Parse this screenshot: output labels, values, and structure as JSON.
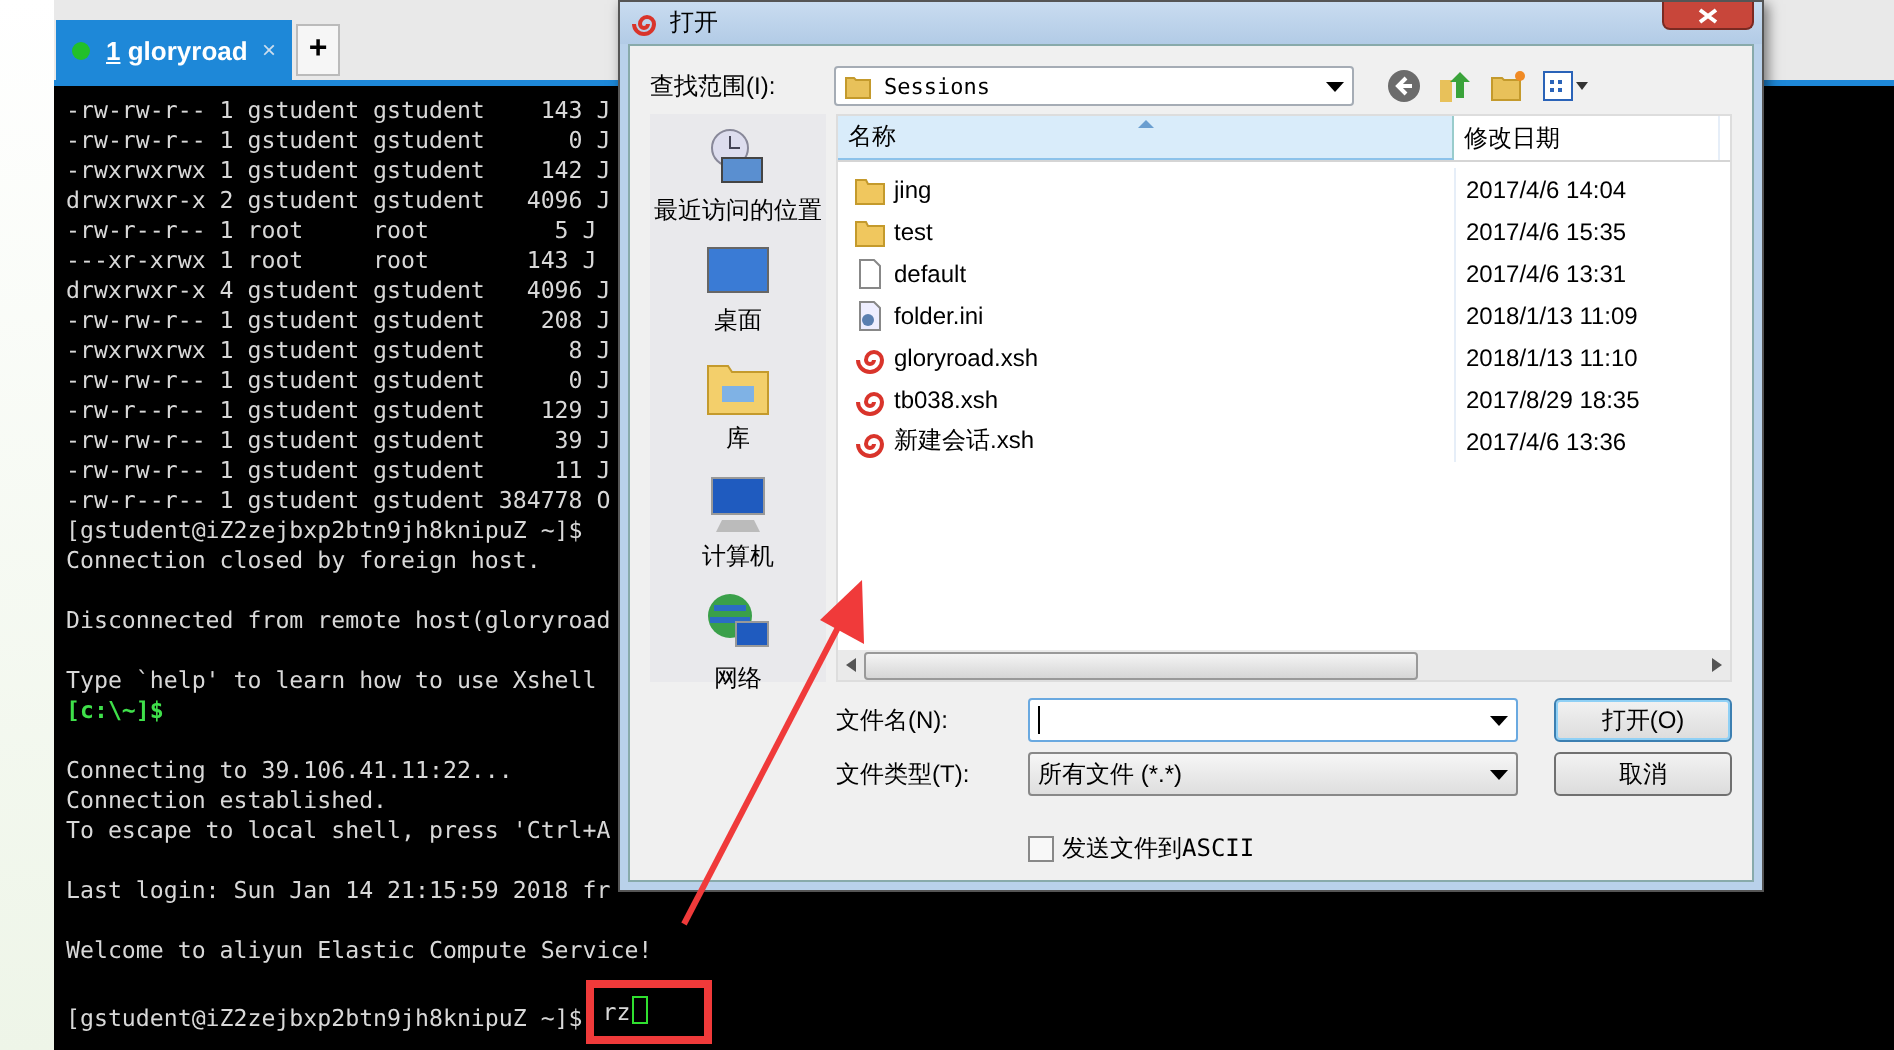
{
  "terminal": {
    "tabs": [
      {
        "number": "1",
        "label": "gloryroad",
        "close": "×",
        "selected": true,
        "connected": true
      }
    ],
    "new_tab": "+",
    "lines": [
      {
        "kind": "output",
        "text": "-rw-rw-r-- 1 gstudent gstudent    143 J"
      },
      {
        "kind": "output",
        "text": "-rw-rw-r-- 1 gstudent gstudent      0 J"
      },
      {
        "kind": "output",
        "text": "-rwxrwxrwx 1 gstudent gstudent    142 J"
      },
      {
        "kind": "output",
        "text": "drwxrwxr-x 2 gstudent gstudent   4096 J"
      },
      {
        "kind": "output",
        "text": "-rw-r--r-- 1 root     root         5 J"
      },
      {
        "kind": "output",
        "text": "---xr-xrwx 1 root     root       143 J"
      },
      {
        "kind": "output",
        "text": "drwxrwxr-x 4 gstudent gstudent   4096 J"
      },
      {
        "kind": "output",
        "text": "-rw-rw-r-- 1 gstudent gstudent    208 J"
      },
      {
        "kind": "output",
        "text": "-rwxrwxrwx 1 gstudent gstudent      8 J"
      },
      {
        "kind": "output",
        "text": "-rw-rw-r-- 1 gstudent gstudent      0 J"
      },
      {
        "kind": "output",
        "text": "-rw-r--r-- 1 gstudent gstudent    129 J"
      },
      {
        "kind": "output",
        "text": "-rw-rw-r-- 1 gstudent gstudent     39 J"
      },
      {
        "kind": "output",
        "text": "-rw-rw-r-- 1 gstudent gstudent     11 J"
      },
      {
        "kind": "output",
        "text": "-rw-r--r-- 1 gstudent gstudent 384778 O"
      },
      {
        "kind": "output",
        "text": "[gstudent@iZ2zejbxp2btn9jh8knipuZ ~]$"
      },
      {
        "kind": "output",
        "text": "Connection closed by foreign host."
      },
      {
        "kind": "blank"
      },
      {
        "kind": "output",
        "text": "Disconnected from remote host(gloryroad"
      },
      {
        "kind": "blank"
      },
      {
        "kind": "output",
        "text": "Type `help' to learn how to use Xshell"
      },
      {
        "kind": "local-prompt",
        "text": "[c:\\~]$"
      },
      {
        "kind": "blank"
      },
      {
        "kind": "output",
        "text": "Connecting to 39.106.41.11:22..."
      },
      {
        "kind": "output",
        "text": "Connection established."
      },
      {
        "kind": "output",
        "text": "To escape to local shell, press 'Ctrl+A"
      },
      {
        "kind": "blank"
      },
      {
        "kind": "output",
        "text": "Last login: Sun Jan 14 21:15:59 2018 fr"
      },
      {
        "kind": "blank"
      },
      {
        "kind": "output",
        "text": "Welcome to aliyun Elastic Compute Service!"
      },
      {
        "kind": "blank"
      }
    ],
    "prompt": {
      "text": "[gstudent@iZ2zejbxp2btn9jh8knipuZ ~]$",
      "command": "rz"
    }
  },
  "dialog": {
    "title": "打开",
    "look_in": {
      "label": "查找范围(I):",
      "value": "Sessions"
    },
    "places": [
      {
        "kind": "recent",
        "label": "最近访问的位置"
      },
      {
        "kind": "desktop",
        "label": "桌面"
      },
      {
        "kind": "library",
        "label": "库"
      },
      {
        "kind": "computer",
        "label": "计算机"
      },
      {
        "kind": "network",
        "label": "网络"
      }
    ],
    "file_list": {
      "columns": [
        "名称",
        "修改日期"
      ],
      "rows": [
        {
          "kind": "folder",
          "name": "jing",
          "date": "2017/4/6 14:04"
        },
        {
          "kind": "folder",
          "name": "test",
          "date": "2017/4/6 15:35"
        },
        {
          "kind": "file",
          "name": "default",
          "date": "2017/4/6 13:31"
        },
        {
          "kind": "settings",
          "name": "folder.ini",
          "date": "2018/1/13 11:09"
        },
        {
          "kind": "session",
          "name": "gloryroad.xsh",
          "date": "2018/1/13 11:10"
        },
        {
          "kind": "session",
          "name": "tb038.xsh",
          "date": "2017/8/29 18:35"
        },
        {
          "kind": "session",
          "name": "新建会话.xsh",
          "date": "2017/4/6 13:36"
        }
      ]
    },
    "file_name": {
      "label": "文件名(N):"
    },
    "file_type": {
      "label": "文件类型(T):",
      "value": "所有文件 (*.*)"
    },
    "buttons": [
      {
        "label": "打开(O)",
        "default": true
      },
      {
        "label": "取消",
        "default": false
      }
    ],
    "send_ascii": {
      "label": "发送文件到ASCII",
      "checked": false
    }
  }
}
